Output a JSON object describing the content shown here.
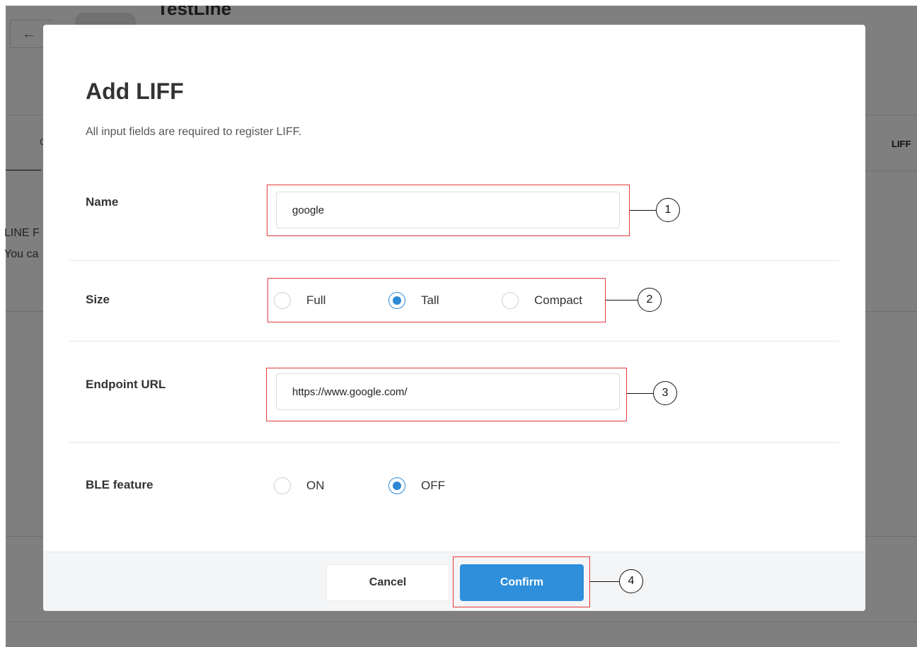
{
  "background": {
    "back_icon": "←",
    "channel_title": "TestLine",
    "tab_partial": "C",
    "tab_liff_partial": "LIFF",
    "text_line1": "LINE F",
    "text_line2": "You ca"
  },
  "modal": {
    "title": "Add LIFF",
    "subtitle": "All input fields are required to register LIFF.",
    "name": {
      "label": "Name",
      "value": "google"
    },
    "size": {
      "label": "Size",
      "options": [
        {
          "label": "Full",
          "checked": false
        },
        {
          "label": "Tall",
          "checked": true
        },
        {
          "label": "Compact",
          "checked": false
        }
      ]
    },
    "endpoint": {
      "label": "Endpoint URL",
      "value": "https://www.google.com/"
    },
    "ble": {
      "label": "BLE feature",
      "options": [
        {
          "label": "ON",
          "checked": false
        },
        {
          "label": "OFF",
          "checked": true
        }
      ]
    },
    "footer": {
      "cancel_label": "Cancel",
      "confirm_label": "Confirm"
    }
  },
  "annotations": [
    "1",
    "2",
    "3",
    "4"
  ],
  "colors": {
    "accent": "#2f8fda",
    "annotation_border": "#e23a3a",
    "overlay": "rgba(0,0,0,0.5)"
  }
}
